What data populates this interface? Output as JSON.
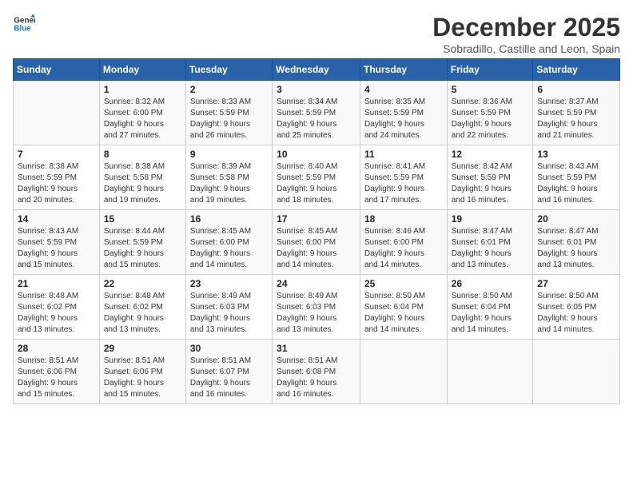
{
  "logo": {
    "line1": "General",
    "line2": "Blue"
  },
  "title": "December 2025",
  "subtitle": "Sobradillo, Castille and Leon, Spain",
  "headers": [
    "Sunday",
    "Monday",
    "Tuesday",
    "Wednesday",
    "Thursday",
    "Friday",
    "Saturday"
  ],
  "weeks": [
    [
      {
        "day": "",
        "info": ""
      },
      {
        "day": "1",
        "info": "Sunrise: 8:32 AM\nSunset: 6:00 PM\nDaylight: 9 hours\nand 27 minutes."
      },
      {
        "day": "2",
        "info": "Sunrise: 8:33 AM\nSunset: 5:59 PM\nDaylight: 9 hours\nand 26 minutes."
      },
      {
        "day": "3",
        "info": "Sunrise: 8:34 AM\nSunset: 5:59 PM\nDaylight: 9 hours\nand 25 minutes."
      },
      {
        "day": "4",
        "info": "Sunrise: 8:35 AM\nSunset: 5:59 PM\nDaylight: 9 hours\nand 24 minutes."
      },
      {
        "day": "5",
        "info": "Sunrise: 8:36 AM\nSunset: 5:59 PM\nDaylight: 9 hours\nand 22 minutes."
      },
      {
        "day": "6",
        "info": "Sunrise: 8:37 AM\nSunset: 5:59 PM\nDaylight: 9 hours\nand 21 minutes."
      }
    ],
    [
      {
        "day": "7",
        "info": "Sunrise: 8:38 AM\nSunset: 5:59 PM\nDaylight: 9 hours\nand 20 minutes."
      },
      {
        "day": "8",
        "info": "Sunrise: 8:38 AM\nSunset: 5:58 PM\nDaylight: 9 hours\nand 19 minutes."
      },
      {
        "day": "9",
        "info": "Sunrise: 8:39 AM\nSunset: 5:58 PM\nDaylight: 9 hours\nand 19 minutes."
      },
      {
        "day": "10",
        "info": "Sunrise: 8:40 AM\nSunset: 5:59 PM\nDaylight: 9 hours\nand 18 minutes."
      },
      {
        "day": "11",
        "info": "Sunrise: 8:41 AM\nSunset: 5:59 PM\nDaylight: 9 hours\nand 17 minutes."
      },
      {
        "day": "12",
        "info": "Sunrise: 8:42 AM\nSunset: 5:59 PM\nDaylight: 9 hours\nand 16 minutes."
      },
      {
        "day": "13",
        "info": "Sunrise: 8:43 AM\nSunset: 5:59 PM\nDaylight: 9 hours\nand 16 minutes."
      }
    ],
    [
      {
        "day": "14",
        "info": "Sunrise: 8:43 AM\nSunset: 5:59 PM\nDaylight: 9 hours\nand 15 minutes."
      },
      {
        "day": "15",
        "info": "Sunrise: 8:44 AM\nSunset: 5:59 PM\nDaylight: 9 hours\nand 15 minutes."
      },
      {
        "day": "16",
        "info": "Sunrise: 8:45 AM\nSunset: 6:00 PM\nDaylight: 9 hours\nand 14 minutes."
      },
      {
        "day": "17",
        "info": "Sunrise: 8:45 AM\nSunset: 6:00 PM\nDaylight: 9 hours\nand 14 minutes."
      },
      {
        "day": "18",
        "info": "Sunrise: 8:46 AM\nSunset: 6:00 PM\nDaylight: 9 hours\nand 14 minutes."
      },
      {
        "day": "19",
        "info": "Sunrise: 8:47 AM\nSunset: 6:01 PM\nDaylight: 9 hours\nand 13 minutes."
      },
      {
        "day": "20",
        "info": "Sunrise: 8:47 AM\nSunset: 6:01 PM\nDaylight: 9 hours\nand 13 minutes."
      }
    ],
    [
      {
        "day": "21",
        "info": "Sunrise: 8:48 AM\nSunset: 6:02 PM\nDaylight: 9 hours\nand 13 minutes."
      },
      {
        "day": "22",
        "info": "Sunrise: 8:48 AM\nSunset: 6:02 PM\nDaylight: 9 hours\nand 13 minutes."
      },
      {
        "day": "23",
        "info": "Sunrise: 8:49 AM\nSunset: 6:03 PM\nDaylight: 9 hours\nand 13 minutes."
      },
      {
        "day": "24",
        "info": "Sunrise: 8:49 AM\nSunset: 6:03 PM\nDaylight: 9 hours\nand 13 minutes."
      },
      {
        "day": "25",
        "info": "Sunrise: 8:50 AM\nSunset: 6:04 PM\nDaylight: 9 hours\nand 14 minutes."
      },
      {
        "day": "26",
        "info": "Sunrise: 8:50 AM\nSunset: 6:04 PM\nDaylight: 9 hours\nand 14 minutes."
      },
      {
        "day": "27",
        "info": "Sunrise: 8:50 AM\nSunset: 6:05 PM\nDaylight: 9 hours\nand 14 minutes."
      }
    ],
    [
      {
        "day": "28",
        "info": "Sunrise: 8:51 AM\nSunset: 6:06 PM\nDaylight: 9 hours\nand 15 minutes."
      },
      {
        "day": "29",
        "info": "Sunrise: 8:51 AM\nSunset: 6:06 PM\nDaylight: 9 hours\nand 15 minutes."
      },
      {
        "day": "30",
        "info": "Sunrise: 8:51 AM\nSunset: 6:07 PM\nDaylight: 9 hours\nand 16 minutes."
      },
      {
        "day": "31",
        "info": "Sunrise: 8:51 AM\nSunset: 6:08 PM\nDaylight: 9 hours\nand 16 minutes."
      },
      {
        "day": "",
        "info": ""
      },
      {
        "day": "",
        "info": ""
      },
      {
        "day": "",
        "info": ""
      }
    ]
  ]
}
